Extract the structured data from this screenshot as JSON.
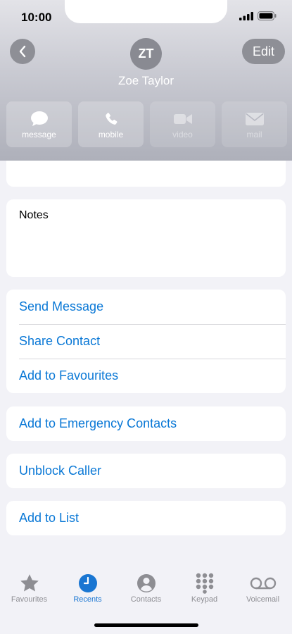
{
  "status_bar": {
    "time": "10:00"
  },
  "contact": {
    "initials": "ZT",
    "name": "Zoe Taylor",
    "edit_label": "Edit"
  },
  "actions": [
    {
      "label": "message",
      "icon": "message-bubble-icon",
      "enabled": true
    },
    {
      "label": "mobile",
      "icon": "phone-icon",
      "enabled": true
    },
    {
      "label": "video",
      "icon": "video-camera-icon",
      "enabled": false
    },
    {
      "label": "mail",
      "icon": "envelope-icon",
      "enabled": false
    }
  ],
  "notes": {
    "label": "Notes"
  },
  "options_group": [
    {
      "label": "Send Message"
    },
    {
      "label": "Share Contact"
    },
    {
      "label": "Add to Favourites"
    }
  ],
  "emergency": {
    "label": "Add to Emergency Contacts"
  },
  "unblock": {
    "label": "Unblock Caller"
  },
  "add_list": {
    "label": "Add to List"
  },
  "tabs": [
    {
      "label": "Favourites",
      "icon": "star-icon",
      "active": false
    },
    {
      "label": "Recents",
      "icon": "clock-icon",
      "active": true
    },
    {
      "label": "Contacts",
      "icon": "person-circle-icon",
      "active": false
    },
    {
      "label": "Keypad",
      "icon": "keypad-icon",
      "active": false
    },
    {
      "label": "Voicemail",
      "icon": "voicemail-icon",
      "active": false
    }
  ],
  "colors": {
    "accent": "#0a78d6",
    "tab_active": "#1a76d2",
    "tab_inactive": "#8e8e93",
    "background": "#f2f2f7"
  }
}
